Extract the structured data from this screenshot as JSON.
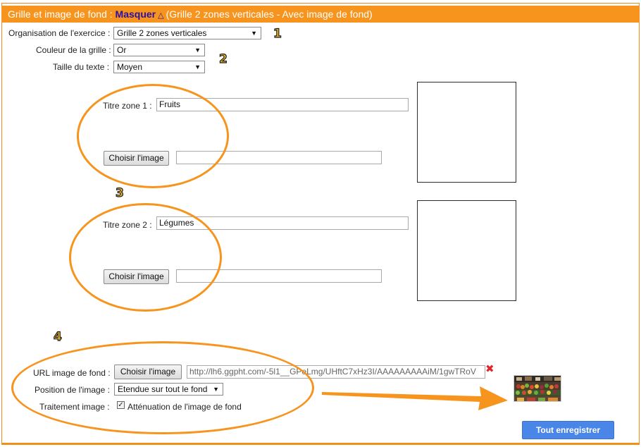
{
  "header": {
    "title": "Grille et image de fond : ",
    "hide_label": "Masquer",
    "hide_icon": "triangle-up-icon",
    "subtitle": "(Grille 2 zones verticales - Avec image de fond)"
  },
  "settings": {
    "organisation": {
      "label": "Organisation de l'exercice :",
      "value": "Grille 2 zones verticales"
    },
    "color": {
      "label": "Couleur de la grille :",
      "value": "Or"
    },
    "text_size": {
      "label": "Taille du texte :",
      "value": "Moyen"
    }
  },
  "zones": [
    {
      "title_label": "Titre zone 1 :",
      "title_value": "Fruits",
      "choose_label": "Choisir l'image",
      "image_value": ""
    },
    {
      "title_label": "Titre zone 2 :",
      "title_value": "Légumes",
      "choose_label": "Choisir l'image",
      "image_value": ""
    }
  ],
  "background": {
    "url_label": "URL image de fond :",
    "choose_label": "Choisir l'image",
    "url_value": "http://lh6.ggpht.com/-5l1__GPeLmg/UHftC7xHz3I/AAAAAAAAAiM/1gwTRoV",
    "position_label": "Position de l'image :",
    "position_value": "Etendue sur tout le fond",
    "treatment_label": "Traitement image :",
    "treatment_option": "Atténuation de l'image de fond",
    "treatment_checked": true
  },
  "annotations": [
    "1",
    "2",
    "3",
    "4"
  ],
  "save_label": "Tout enregistrer",
  "colors": {
    "accent": "#f7941d",
    "link": "#2a0fa5",
    "save_button": "#4a86e8",
    "remove": "#e0262a"
  }
}
